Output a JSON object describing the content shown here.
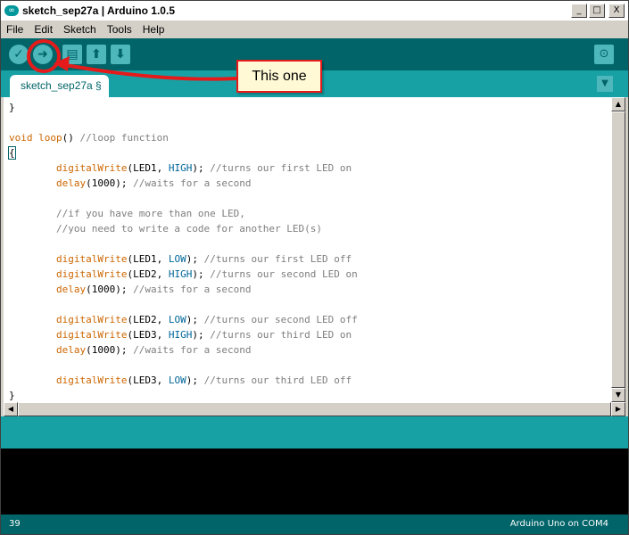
{
  "window": {
    "title": "sketch_sep27a | Arduino 1.0.5",
    "logo_text": "∞",
    "controls": [
      "_",
      "□",
      "X"
    ]
  },
  "menu": {
    "items": [
      "File",
      "Edit",
      "Sketch",
      "Tools",
      "Help"
    ]
  },
  "toolbar": {
    "buttons": [
      {
        "name": "verify-button",
        "icon": "check-icon"
      },
      {
        "name": "upload-button",
        "icon": "arrow-right-icon"
      },
      {
        "name": "new-button",
        "icon": "new-file-icon"
      },
      {
        "name": "open-button",
        "icon": "arrow-up-icon"
      },
      {
        "name": "save-button",
        "icon": "arrow-down-icon"
      }
    ],
    "serial_monitor_icon": "magnifier-icon"
  },
  "tab": {
    "label": "sketch_sep27a §"
  },
  "callout": {
    "text": "This one",
    "color": "#e51b1b"
  },
  "editor": {
    "lines": [
      [
        {
          "t": "}"
        }
      ],
      [
        {
          "t": ""
        }
      ],
      [
        {
          "t": "void",
          "c": "kw"
        },
        {
          "t": " "
        },
        {
          "t": "loop",
          "c": "kw"
        },
        {
          "t": "() "
        },
        {
          "t": "//loop function",
          "c": "cmt"
        }
      ],
      [
        {
          "t": "{",
          "c": "brace"
        }
      ],
      [
        {
          "t": "        "
        },
        {
          "t": "digitalWrite",
          "c": "kw"
        },
        {
          "t": "(LED1, "
        },
        {
          "t": "HIGH",
          "c": "lit"
        },
        {
          "t": "); "
        },
        {
          "t": "//turns our first LED on",
          "c": "cmt"
        }
      ],
      [
        {
          "t": "        "
        },
        {
          "t": "delay",
          "c": "kw"
        },
        {
          "t": "(1000); "
        },
        {
          "t": "//waits for a second",
          "c": "cmt"
        }
      ],
      [
        {
          "t": ""
        }
      ],
      [
        {
          "t": "        "
        },
        {
          "t": "//if you have more than one LED,",
          "c": "cmt"
        }
      ],
      [
        {
          "t": "        "
        },
        {
          "t": "//you need to write a code for another LED(s)",
          "c": "cmt"
        }
      ],
      [
        {
          "t": ""
        }
      ],
      [
        {
          "t": "        "
        },
        {
          "t": "digitalWrite",
          "c": "kw"
        },
        {
          "t": "(LED1, "
        },
        {
          "t": "LOW",
          "c": "lit"
        },
        {
          "t": "); "
        },
        {
          "t": "//turns our first LED off",
          "c": "cmt"
        }
      ],
      [
        {
          "t": "        "
        },
        {
          "t": "digitalWrite",
          "c": "kw"
        },
        {
          "t": "(LED2, "
        },
        {
          "t": "HIGH",
          "c": "lit"
        },
        {
          "t": "); "
        },
        {
          "t": "//turns our second LED on",
          "c": "cmt"
        }
      ],
      [
        {
          "t": "        "
        },
        {
          "t": "delay",
          "c": "kw"
        },
        {
          "t": "(1000); "
        },
        {
          "t": "//waits for a second",
          "c": "cmt"
        }
      ],
      [
        {
          "t": ""
        }
      ],
      [
        {
          "t": "        "
        },
        {
          "t": "digitalWrite",
          "c": "kw"
        },
        {
          "t": "(LED2, "
        },
        {
          "t": "LOW",
          "c": "lit"
        },
        {
          "t": "); "
        },
        {
          "t": "//turns our second LED off",
          "c": "cmt"
        }
      ],
      [
        {
          "t": "        "
        },
        {
          "t": "digitalWrite",
          "c": "kw"
        },
        {
          "t": "(LED3, "
        },
        {
          "t": "HIGH",
          "c": "lit"
        },
        {
          "t": "); "
        },
        {
          "t": "//turns our third LED on",
          "c": "cmt"
        }
      ],
      [
        {
          "t": "        "
        },
        {
          "t": "delay",
          "c": "kw"
        },
        {
          "t": "(1000); "
        },
        {
          "t": "//waits for a second",
          "c": "cmt"
        }
      ],
      [
        {
          "t": ""
        }
      ],
      [
        {
          "t": "        "
        },
        {
          "t": "digitalWrite",
          "c": "kw"
        },
        {
          "t": "(LED3, "
        },
        {
          "t": "LOW",
          "c": "lit"
        },
        {
          "t": "); "
        },
        {
          "t": "//turns our third LED off",
          "c": "cmt"
        }
      ],
      [
        {
          "t": "}"
        }
      ]
    ]
  },
  "status": {
    "line_number": "39",
    "board": "Arduino Uno on COM4"
  },
  "colors": {
    "toolbar": "#006468",
    "tab_strip": "#17a1a5",
    "keyword": "#cc6600",
    "comment": "#7e7e7e",
    "constant": "#006699"
  }
}
